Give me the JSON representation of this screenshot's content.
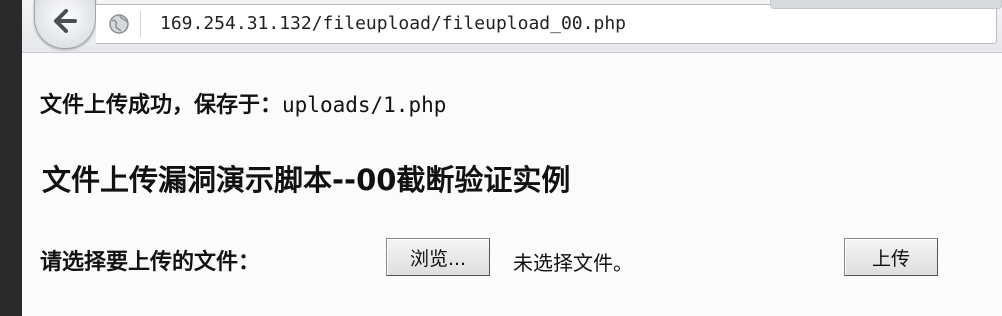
{
  "browser": {
    "url": "169.254.31.132/fileupload/fileupload_00.php"
  },
  "page": {
    "status_prefix": "文件上传成功，保存于：",
    "status_path": "uploads/1.php",
    "heading": "文件上传漏洞演示脚本--00截断验证实例",
    "form": {
      "label": "请选择要上传的文件：",
      "browse_label": "浏览...",
      "no_file_text": "未选择文件。",
      "upload_label": "上传"
    }
  }
}
